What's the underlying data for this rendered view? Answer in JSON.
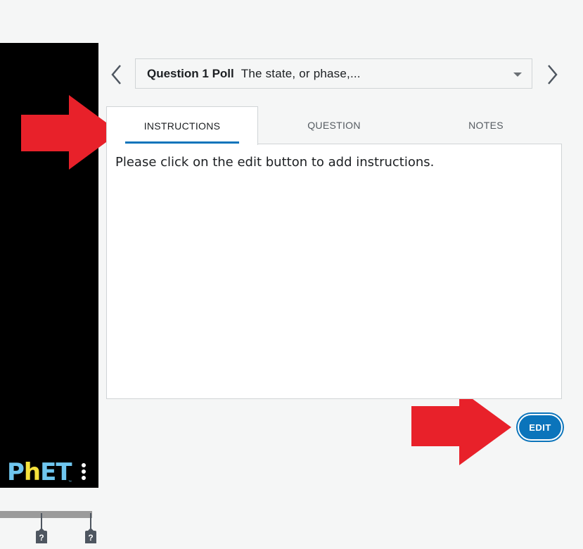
{
  "question_selector": {
    "title": "Question 1 Poll",
    "preview": "The state, or phase,..."
  },
  "tabs": [
    {
      "label": "INSTRUCTIONS",
      "active": true
    },
    {
      "label": "QUESTION",
      "active": false
    },
    {
      "label": "NOTES",
      "active": false
    }
  ],
  "instructions": {
    "text": "Please click on the edit button to add instructions."
  },
  "edit_button": {
    "label": "EDIT"
  },
  "sim": {
    "logo": "PhET",
    "help_markers": [
      "?",
      "?"
    ]
  },
  "colors": {
    "accent": "#0b74bb",
    "annotation": "#e8212a",
    "background": "#f5f6f6"
  },
  "icons": [
    "chevron-left-icon",
    "chevron-right-icon",
    "dropdown-caret-icon",
    "kebab-menu-icon",
    "help-marker-icon",
    "red-arrow-annotation"
  ]
}
